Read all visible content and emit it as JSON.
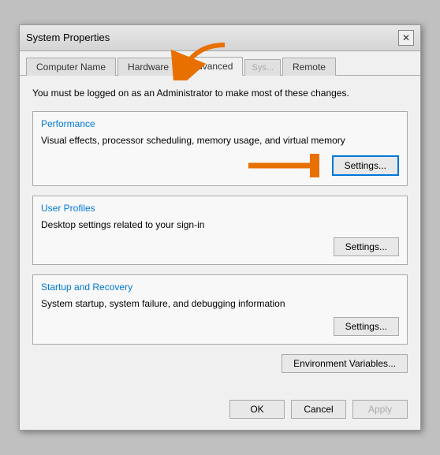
{
  "dialog": {
    "title": "System Properties",
    "close_label": "✕"
  },
  "tabs": [
    {
      "label": "Computer Name",
      "active": false
    },
    {
      "label": "Hardware",
      "active": false
    },
    {
      "label": "Advanced",
      "active": true
    },
    {
      "label": "System Protection",
      "active": false,
      "hidden": true
    },
    {
      "label": "Remote",
      "active": false
    }
  ],
  "admin_notice": "You must be logged on as an Administrator to make most of these changes.",
  "sections": {
    "performance": {
      "title": "Performance",
      "description": "Visual effects, processor scheduling, memory usage, and virtual memory",
      "settings_label": "Settings..."
    },
    "user_profiles": {
      "title": "User Profiles",
      "description": "Desktop settings related to your sign-in",
      "settings_label": "Settings..."
    },
    "startup_recovery": {
      "title": "Startup and Recovery",
      "description": "System startup, system failure, and debugging information",
      "settings_label": "Settings..."
    }
  },
  "env_variables_label": "Environment Variables...",
  "bottom_buttons": {
    "ok_label": "OK",
    "cancel_label": "Cancel",
    "apply_label": "Apply"
  }
}
